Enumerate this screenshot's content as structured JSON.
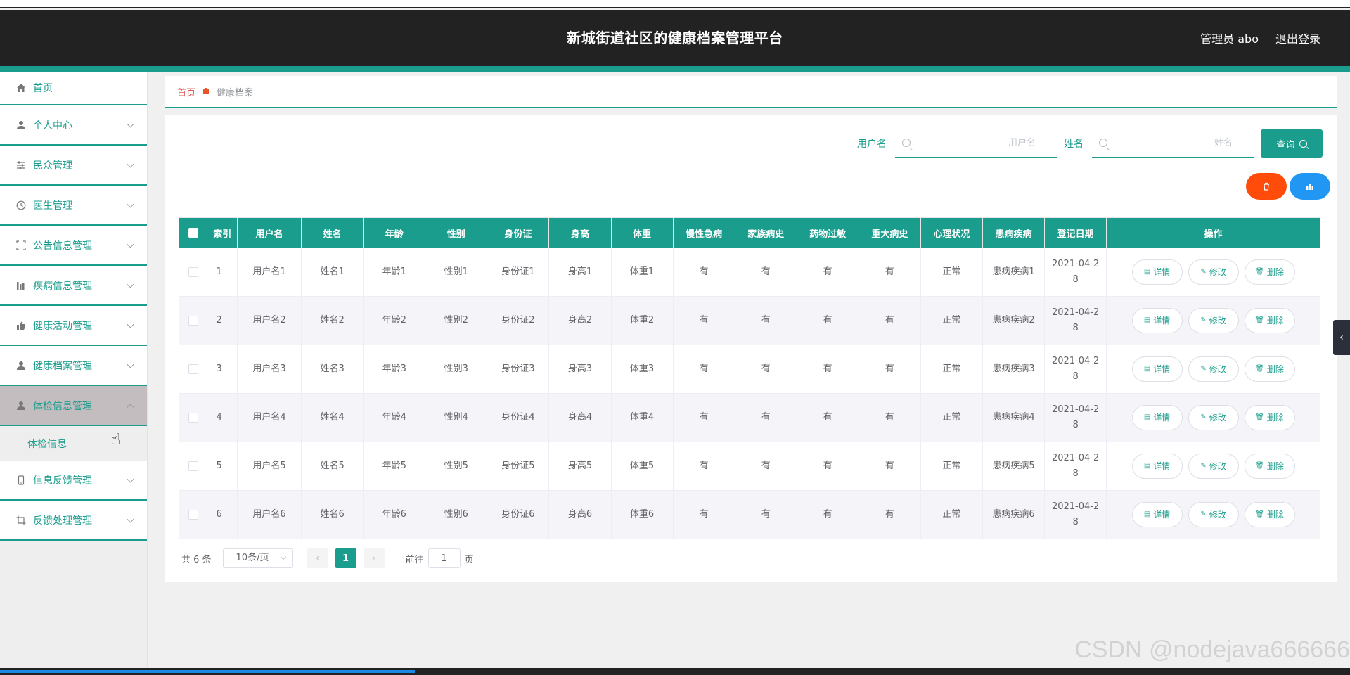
{
  "header": {
    "title": "新城街道社区的健康档案管理平台",
    "admin_label": "管理员 abo",
    "logout_label": "退出登录"
  },
  "sidebar": {
    "items": [
      {
        "label": "首页",
        "icon": "home-icon"
      },
      {
        "label": "个人中心",
        "icon": "user-icon"
      },
      {
        "label": "民众管理",
        "icon": "sliders-icon"
      },
      {
        "label": "医生管理",
        "icon": "clock-icon"
      },
      {
        "label": "公告信息管理",
        "icon": "fullscreen-icon"
      },
      {
        "label": "疾病信息管理",
        "icon": "bar-chart-icon"
      },
      {
        "label": "健康活动管理",
        "icon": "thumb-up-icon"
      },
      {
        "label": "健康档案管理",
        "icon": "user-icon"
      },
      {
        "label": "体检信息管理",
        "icon": "user-icon"
      },
      {
        "label": "信息反馈管理",
        "icon": "phone-icon"
      },
      {
        "label": "反馈处理管理",
        "icon": "crop-icon"
      }
    ],
    "submenu_label": "体检信息"
  },
  "breadcrumb": {
    "home": "首页",
    "current": "健康档案"
  },
  "search": {
    "username_label": "用户名",
    "username_placeholder": "用户名",
    "name_label": "姓名",
    "name_placeholder": "姓名",
    "query_label": "查询"
  },
  "table": {
    "headers": [
      "",
      "索引",
      "用户名",
      "姓名",
      "年龄",
      "性别",
      "身份证",
      "身高",
      "体重",
      "慢性急病",
      "家族病史",
      "药物过敏",
      "重大病史",
      "心理状况",
      "患病疾病",
      "登记日期",
      "操作"
    ],
    "rows": [
      {
        "index": "1",
        "username": "用户名1",
        "name": "姓名1",
        "age": "年龄1",
        "gender": "性别1",
        "id_card": "身份证1",
        "height": "身高1",
        "weight": "体重1",
        "chronic": "有",
        "family": "有",
        "allergy": "有",
        "major": "有",
        "mental": "正常",
        "disease": "患病疾病1",
        "date": "2021-04-28"
      },
      {
        "index": "2",
        "username": "用户名2",
        "name": "姓名2",
        "age": "年龄2",
        "gender": "性别2",
        "id_card": "身份证2",
        "height": "身高2",
        "weight": "体重2",
        "chronic": "有",
        "family": "有",
        "allergy": "有",
        "major": "有",
        "mental": "正常",
        "disease": "患病疾病2",
        "date": "2021-04-28"
      },
      {
        "index": "3",
        "username": "用户名3",
        "name": "姓名3",
        "age": "年龄3",
        "gender": "性别3",
        "id_card": "身份证3",
        "height": "身高3",
        "weight": "体重3",
        "chronic": "有",
        "family": "有",
        "allergy": "有",
        "major": "有",
        "mental": "正常",
        "disease": "患病疾病3",
        "date": "2021-04-28"
      },
      {
        "index": "4",
        "username": "用户名4",
        "name": "姓名4",
        "age": "年龄4",
        "gender": "性别4",
        "id_card": "身份证4",
        "height": "身高4",
        "weight": "体重4",
        "chronic": "有",
        "family": "有",
        "allergy": "有",
        "major": "有",
        "mental": "正常",
        "disease": "患病疾病4",
        "date": "2021-04-28"
      },
      {
        "index": "5",
        "username": "用户名5",
        "name": "姓名5",
        "age": "年龄5",
        "gender": "性别5",
        "id_card": "身份证5",
        "height": "身高5",
        "weight": "体重5",
        "chronic": "有",
        "family": "有",
        "allergy": "有",
        "major": "有",
        "mental": "正常",
        "disease": "患病疾病5",
        "date": "2021-04-28"
      },
      {
        "index": "6",
        "username": "用户名6",
        "name": "姓名6",
        "age": "年龄6",
        "gender": "性别6",
        "id_card": "身份证6",
        "height": "身高6",
        "weight": "体重6",
        "chronic": "有",
        "family": "有",
        "allergy": "有",
        "major": "有",
        "mental": "正常",
        "disease": "患病疾病6",
        "date": "2021-04-28"
      }
    ],
    "actions": {
      "detail": "详情",
      "edit": "修改",
      "delete": "删除"
    }
  },
  "pagination": {
    "total": "共 6 条",
    "page_size": "10条/页",
    "current_page": "1",
    "goto_prefix": "前往",
    "goto_value": "1",
    "goto_suffix": "页"
  },
  "watermark": "CSDN @nodejava666666",
  "colors": {
    "primary": "#1b9d8d",
    "header_bg": "#222222",
    "delete_red": "#ff4c0a",
    "chart_blue": "#2196f3"
  }
}
